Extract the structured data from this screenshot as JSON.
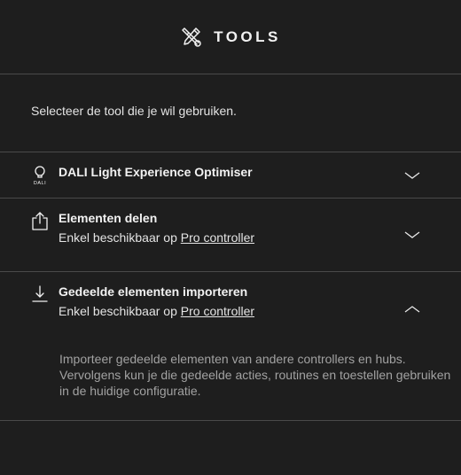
{
  "header": {
    "icon": "tools-icon",
    "title": "TOOLS"
  },
  "intro": {
    "text": "Selecteer de tool die je wil gebruiken."
  },
  "items": [
    {
      "icon": "dali-bulb-icon",
      "icon_caption": "DALI",
      "name": "DALI Light Experience Optimiser",
      "expanded": false
    },
    {
      "icon": "share-icon",
      "name": "Elementen delen",
      "availability_prefix": "Enkel beschikbaar op ",
      "availability_link": "Pro controller",
      "expanded": false
    },
    {
      "icon": "import-icon",
      "name": "Gedeelde elementen importeren",
      "availability_prefix": "Enkel beschikbaar op ",
      "availability_link": "Pro controller",
      "expanded": true,
      "description": "Importeer gedeelde elementen van andere controllers en hubs. Vervolgens kun je die gedeelde acties, routines en toestellen gebruiken in de huidige configuratie."
    }
  ],
  "colors": {
    "background": "#1e1e1e",
    "divider": "#4a4a4a",
    "text": "#e8e8e8",
    "muted_text": "#a2a2a2"
  }
}
